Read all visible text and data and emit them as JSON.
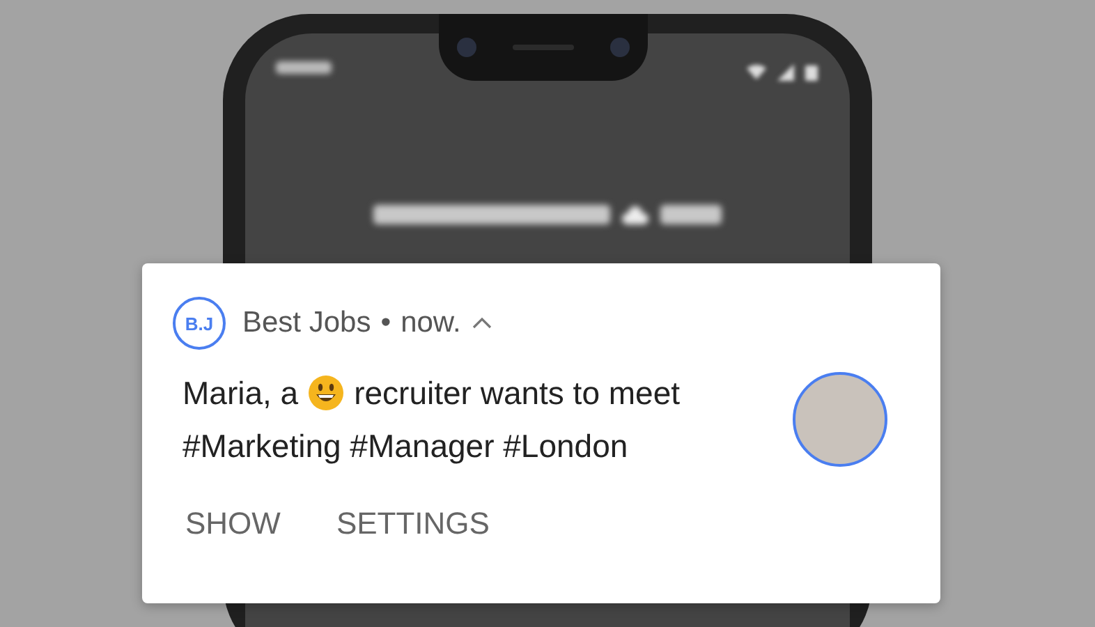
{
  "notification": {
    "app_icon_text": "B.J",
    "app_name": "Best Jobs",
    "separator": "•",
    "time": "now.",
    "expanded": true,
    "message": {
      "before_emoji": "Maria, a",
      "after_emoji": "recruiter wants to meet",
      "line_2": "#Marketing #Manager #London"
    },
    "actions": [
      "SHOW",
      "SETTINGS"
    ]
  }
}
